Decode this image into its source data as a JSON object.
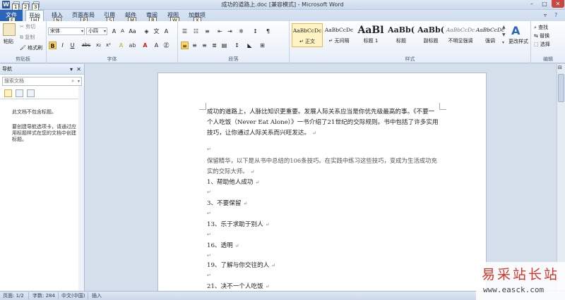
{
  "window": {
    "title": "成功的道路上.doc [兼容模式] - Microsoft Word",
    "app_icon_letter": "W",
    "controls": [
      "–",
      "□",
      "✕"
    ]
  },
  "quick_access": {
    "key_tips": [
      "1",
      "2",
      "3"
    ]
  },
  "ribbon_tabs": {
    "file": "文件",
    "items": [
      {
        "label": "开始",
        "key": "H"
      },
      {
        "label": "插入",
        "key": "N"
      },
      {
        "label": "页面布局",
        "key": "P"
      },
      {
        "label": "引用",
        "key": "S"
      },
      {
        "label": "邮件",
        "key": "M"
      },
      {
        "label": "审阅",
        "key": "R"
      },
      {
        "label": "视图",
        "key": "W"
      },
      {
        "label": "加载项",
        "key": "X"
      }
    ],
    "file_key": "F"
  },
  "clipboard": {
    "paste": "粘贴",
    "cut": "剪切",
    "copy": "复制",
    "format_painter": "格式刷",
    "label": "剪贴板"
  },
  "font": {
    "font_name": "宋体",
    "font_size": "小四",
    "bold": "B",
    "italic": "I",
    "underline": "U",
    "strike": "abc",
    "subscript": "x₂",
    "superscript": "x²",
    "label": "字体"
  },
  "paragraph": {
    "label": "段落"
  },
  "styles": {
    "items": [
      {
        "preview": "AaBbCcDc",
        "name": "↵ 正文"
      },
      {
        "preview": "AaBbCcDc",
        "name": "↵ 无间隔"
      },
      {
        "preview": "AaBl",
        "name": "标题 1"
      },
      {
        "preview": "AaBb(",
        "name": "标题"
      },
      {
        "preview": "AaBb(",
        "name": "副标题"
      },
      {
        "preview": "AaBbCcDc",
        "name": "不明显强调"
      },
      {
        "preview": "AaBbCcDc",
        "name": "强调"
      }
    ],
    "change_styles": "更改样式",
    "label": "样式"
  },
  "editing": {
    "find": "查找",
    "replace": "替换",
    "select": "选择",
    "label": "编辑"
  },
  "nav_pane": {
    "title": "导航",
    "search_placeholder": "搜索文档",
    "msg1": "此文档不包含标题。",
    "msg2": "要创建导航选项卡，请通过应用标题样式在您的文档中创建标题。"
  },
  "document": {
    "para1": "成功的道路上，人脉比知识更重要。发展人际关系应当是你优先级最高的事。《不要一个人吃饭（Never Eat Alone）》一书介绍了21世纪的交际规则。书中包括了许多实用技巧，让你通过人际关系而兴旺发达。",
    "para2": "保留精华，以下是从书中总结的106条技巧。在实践中练习这些技巧，变成为生活成功充实的交际大师。",
    "items": [
      "1、帮助他人成功",
      "3、不要保留",
      "13、乐于求助于别人",
      "16、透明",
      "19、了解与你交往的人",
      "21、决不一个人吃饭"
    ],
    "para_mark": "↵"
  },
  "status_bar": {
    "page": "页面: 1/2",
    "words": "字数: 284",
    "language": "中文(中国)",
    "mode": "插入"
  },
  "watermark": {
    "title": "易采站长站",
    "url": "www.easck.com"
  },
  "colors": {
    "file_tab": "#2a65b8",
    "close_button": "#c9483f",
    "watermark_red": "#d73527"
  }
}
